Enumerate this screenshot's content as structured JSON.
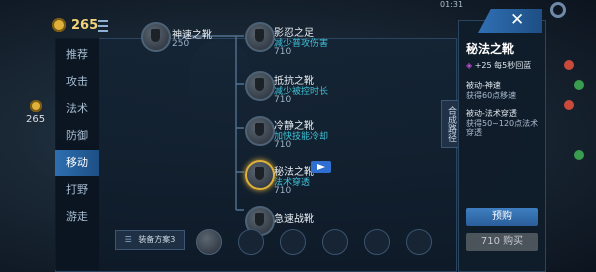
{
  "currency": {
    "gold": "265",
    "side_gold": "265"
  },
  "tabs": [
    "推荐",
    "攻击",
    "法术",
    "防御",
    "移动",
    "打野",
    "游走"
  ],
  "active_tab": "移动",
  "tree": {
    "root": {
      "name": "神速之靴",
      "price": "250"
    },
    "items": [
      {
        "name": "影忍之足",
        "desc": "减少普攻伤害",
        "price": "710"
      },
      {
        "name": "抵抗之靴",
        "desc": "减少被控时长",
        "price": "710"
      },
      {
        "name": "冷静之靴",
        "desc": "加快技能冷却",
        "price": "710"
      },
      {
        "name": "秘法之靴",
        "desc": "法术穿透",
        "price": "710"
      },
      {
        "name": "急速战靴",
        "desc": "",
        "price": ""
      }
    ]
  },
  "synthesis_tab": "合成路径",
  "detail": {
    "title": "秘法之靴",
    "stat": "+25 每5秒回蓝",
    "passive1_title": "被动-神速",
    "passive1_desc": "获得60点移速",
    "passive2_title": "被动-法术穿透",
    "passive2_desc_1": "获得50~120点法术",
    "passive2_desc_2": "穿透",
    "preorder_label": "预购",
    "buy_label": "710 购买"
  },
  "equip_plan": {
    "label": "装备方案3"
  },
  "hud": {
    "clock": "01:31"
  },
  "colors": {
    "accent": "#2d6fb0",
    "gold": "#e0b13a",
    "desc": "#3fc2d8"
  }
}
